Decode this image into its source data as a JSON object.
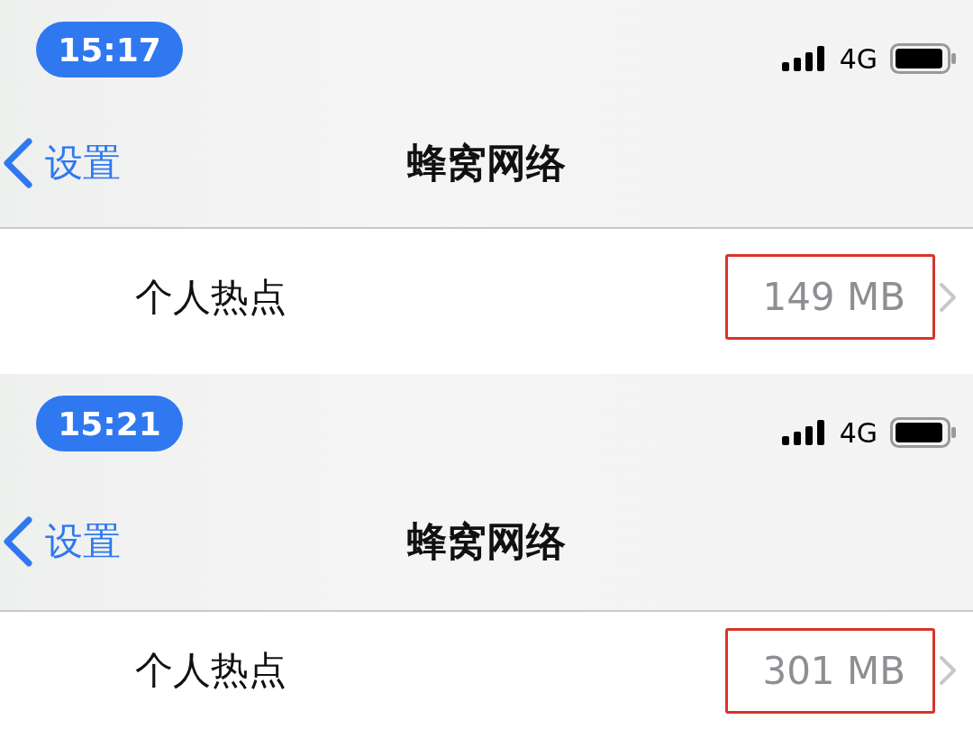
{
  "screenshots": [
    {
      "time": "15:17",
      "network": "4G",
      "back_label": "设置",
      "title": "蜂窝网络",
      "row": {
        "label": "个人热点",
        "value": "149 MB",
        "highlighted": true
      }
    },
    {
      "time": "15:21",
      "network": "4G",
      "back_label": "设置",
      "title": "蜂窝网络",
      "row": {
        "label": "个人热点",
        "value": "301 MB",
        "highlighted": true
      }
    }
  ]
}
